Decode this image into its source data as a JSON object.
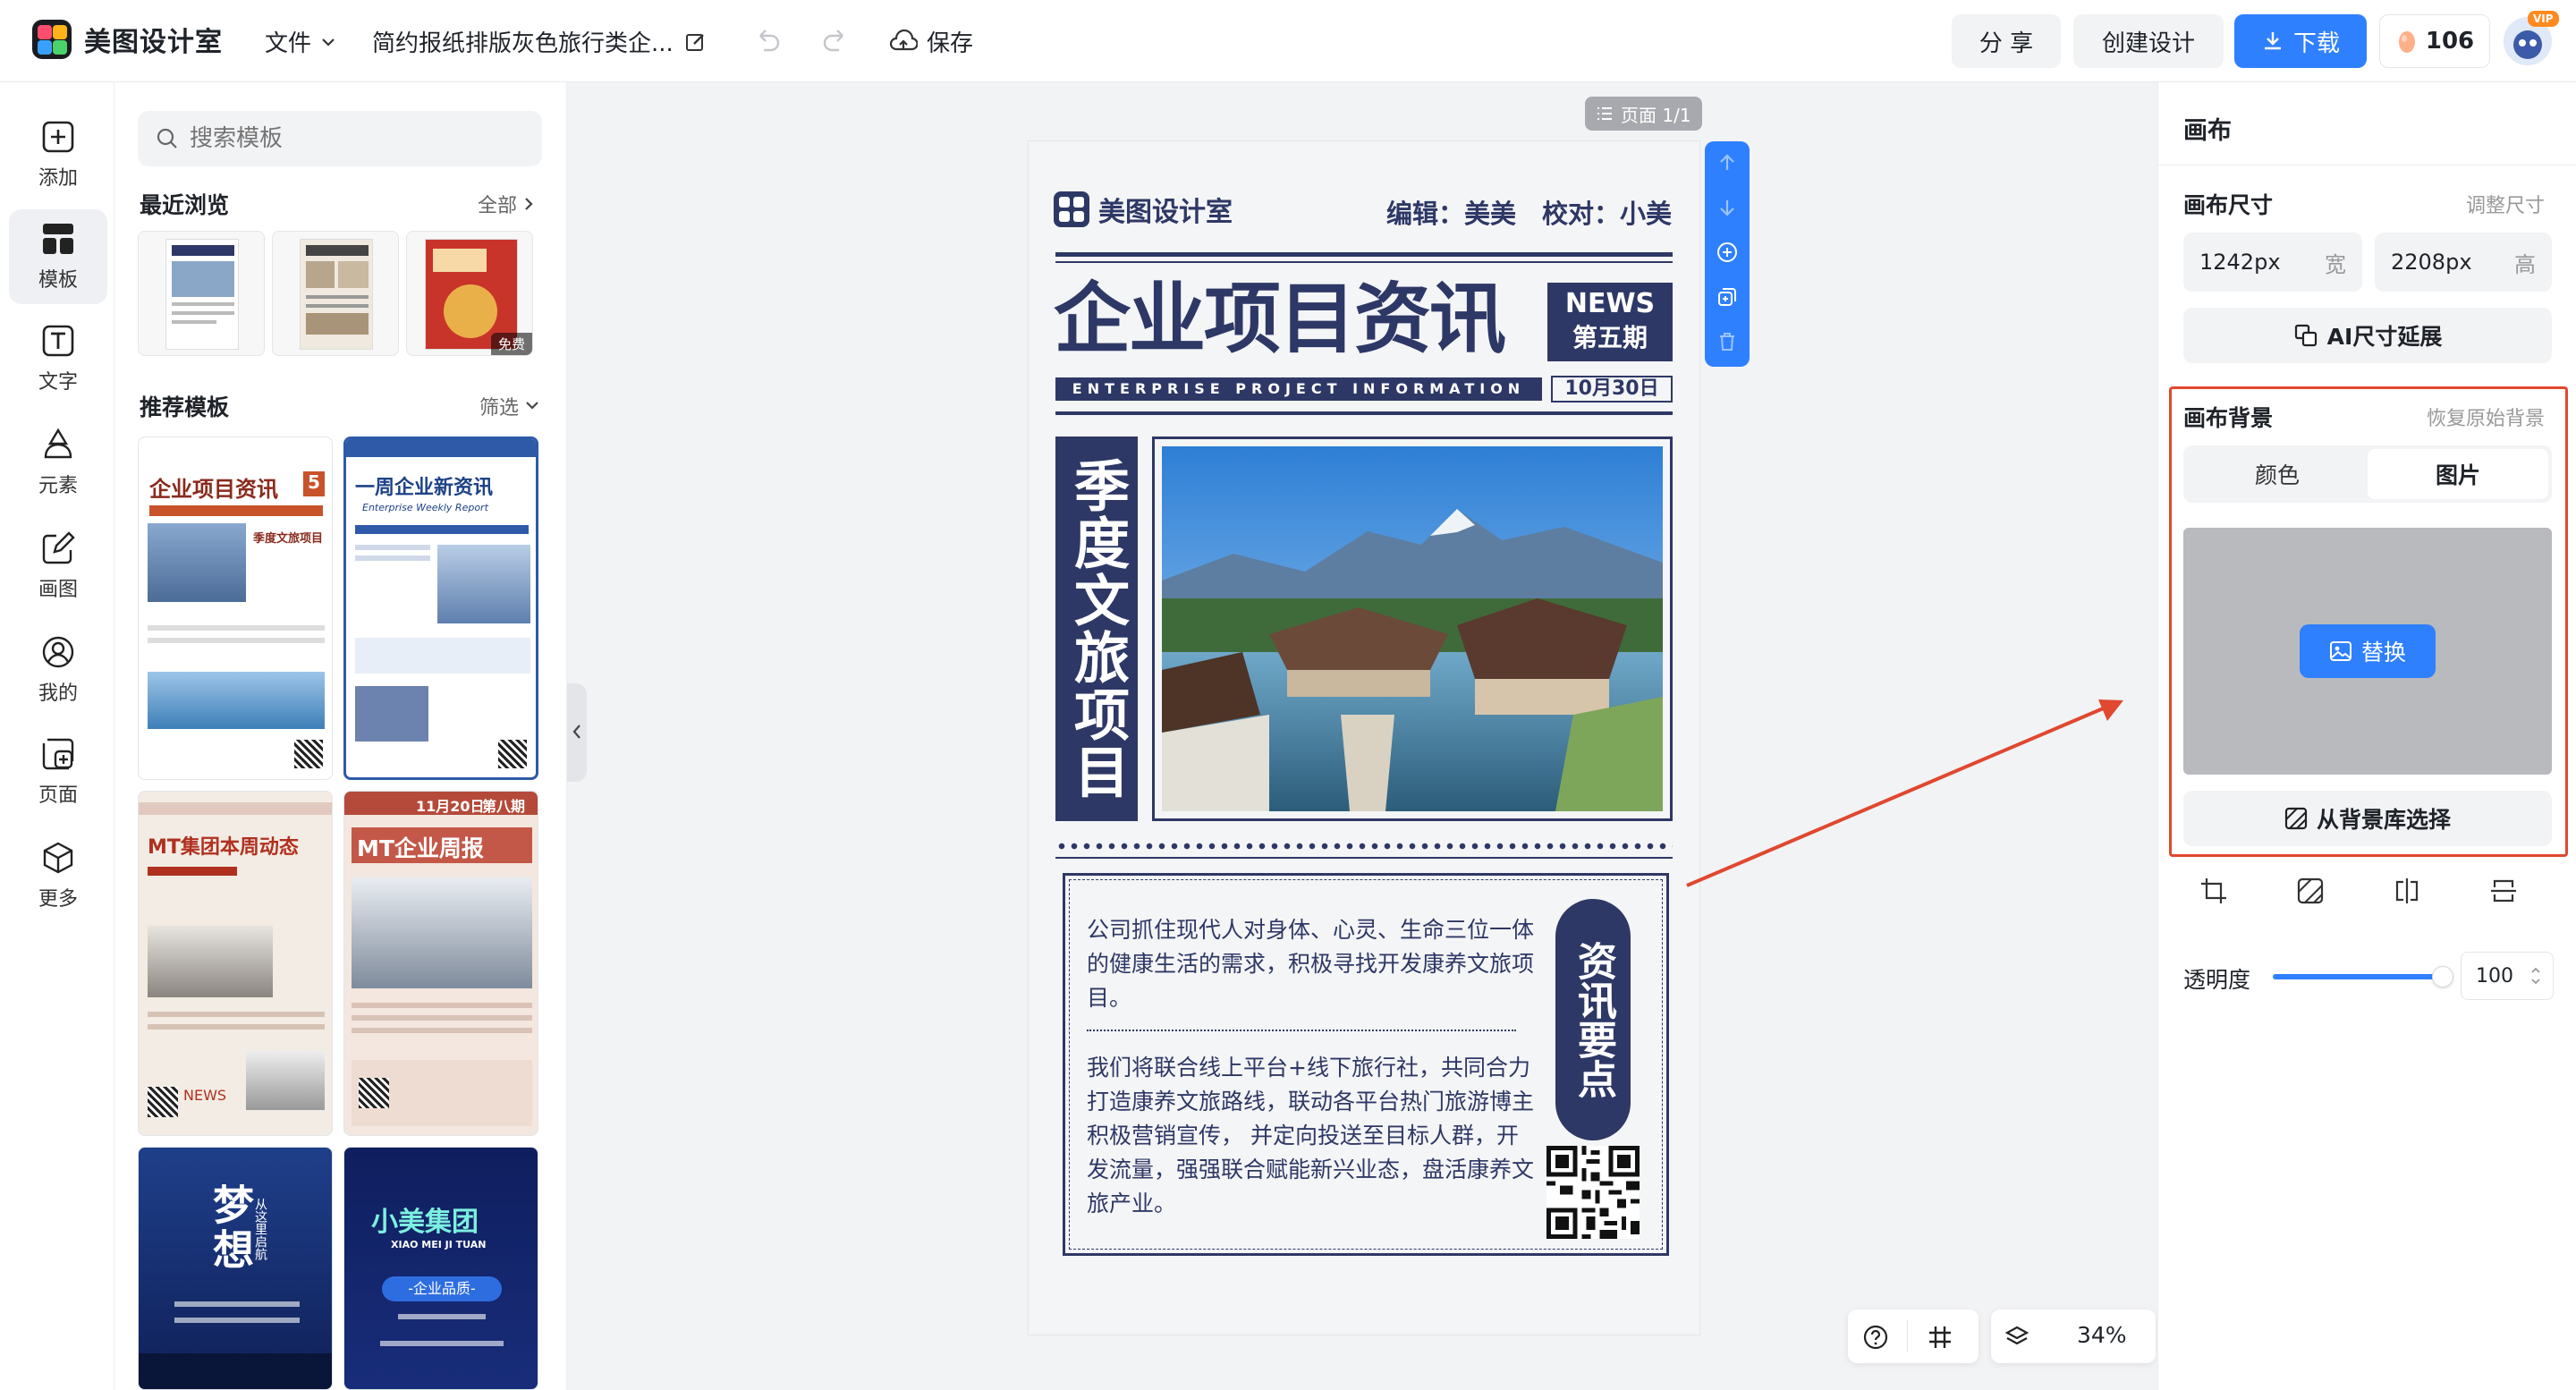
{
  "app": {
    "name": "美图设计室"
  },
  "topbar": {
    "file_menu": "文件",
    "doc_title": "简约报纸排版灰色旅行类企...",
    "save_label": "保存",
    "share_label": "分 享",
    "create_label": "创建设计",
    "download_label": "下载",
    "credits": "106",
    "vip_badge": "VIP"
  },
  "rail": {
    "items": [
      {
        "label": "添加",
        "icon": "plus-square-icon"
      },
      {
        "label": "模板",
        "icon": "template-grid-icon"
      },
      {
        "label": "文字",
        "icon": "text-icon"
      },
      {
        "label": "元素",
        "icon": "shapes-icon"
      },
      {
        "label": "画图",
        "icon": "pencil-icon"
      },
      {
        "label": "我的",
        "icon": "user-icon"
      },
      {
        "label": "页面",
        "icon": "page-add-icon"
      },
      {
        "label": "更多",
        "icon": "box-icon"
      }
    ]
  },
  "templates": {
    "search_placeholder": "搜索模板",
    "recent_title": "最近浏览",
    "recent_all": "全部",
    "free_badge": "免费",
    "recommended_title": "推荐模板",
    "filter_label": "筛选",
    "cards": [
      {
        "title": "企业项目资讯",
        "issue": "5",
        "sub": "季度文旅项目"
      },
      {
        "title": "一周企业新资讯",
        "sub": "Enterprise Weekly Report"
      },
      {
        "title": "MT集团本周动态",
        "sub": "NEWS"
      },
      {
        "title": "MT企业周报",
        "date": "11月20日",
        "issue": "第八期"
      },
      {
        "title": "梦想",
        "sub": "从这里启航"
      },
      {
        "title": "小美集团",
        "sub": "XIAO MEI JI TUAN",
        "pill": "-企业品质-"
      }
    ]
  },
  "canvas": {
    "page_indicator": "页面 1/1",
    "zoom": "34%",
    "poster": {
      "brand": "美图设计室",
      "editor_line": "编辑：美美　校对：小美",
      "headline": "企业项目资讯",
      "news_en": "NEWS",
      "issue": "第五期",
      "subtitle_en": "ENTERPRISE PROJECT INFORMATION",
      "date": "10月30日",
      "vertical_title": "季度文旅项目",
      "para1": "公司抓住现代人对身体、心灵、生命三位一体的健康生活的需求，积极寻找开发康养文旅项目。",
      "para2": "我们将联合线上平台+线下旅行社，共同合力打造康养文旅路线，联动各平台热门旅游博主积极营销宣传， 并定向投送至目标人群，开发流量，强强联合赋能新兴业态，盘活康养文旅产业。",
      "side_title": "资讯要点"
    }
  },
  "right_panel": {
    "title": "画布",
    "size_title": "画布尺寸",
    "resize_link": "调整尺寸",
    "width_value": "1242px",
    "width_unit": "宽",
    "height_value": "2208px",
    "height_unit": "高",
    "ai_expand": "AI尺寸延展",
    "bg_title": "画布背景",
    "restore_bg": "恢复原始背景",
    "tab_color": "颜色",
    "tab_image": "图片",
    "replace_label": "替换",
    "library_label": "从背景库选择",
    "opacity_label": "透明度",
    "opacity_value": "100",
    "opacity_level": 1.0
  },
  "colors": {
    "accent_blue": "#2f80ff",
    "poster_navy": "#2e3866",
    "highlight_red": "#e0482f"
  }
}
